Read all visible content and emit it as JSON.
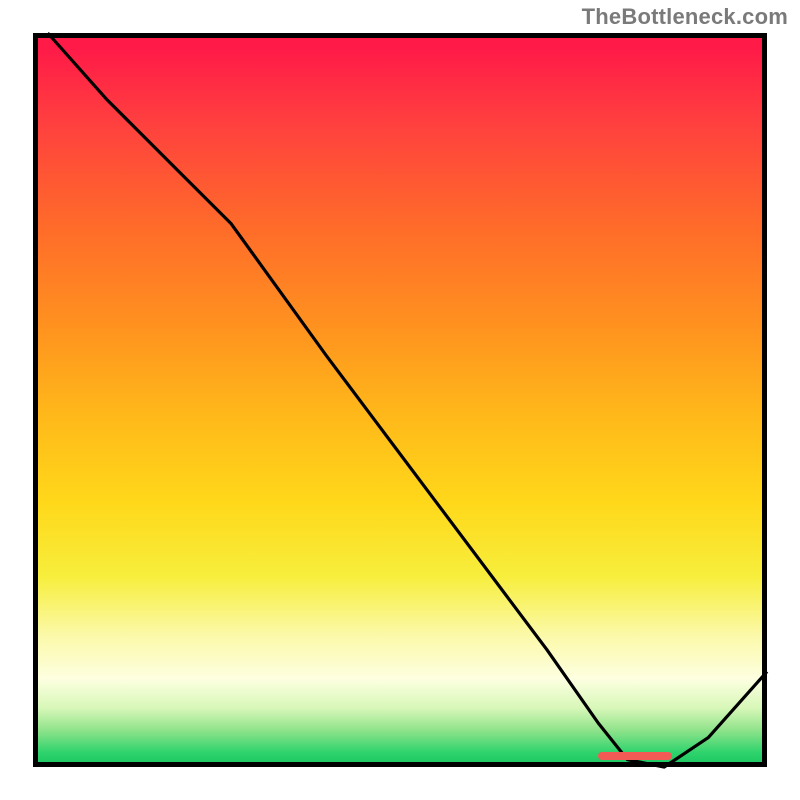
{
  "watermark": {
    "text": "TheBottleneck.com"
  },
  "chart_data": {
    "type": "line",
    "title": "",
    "xlabel": "",
    "ylabel": "",
    "xlim": [
      0,
      100
    ],
    "ylim": [
      0,
      100
    ],
    "grid": false,
    "legend": false,
    "series": [
      {
        "name": "curve",
        "x": [
          2,
          10,
          20,
          27,
          40,
          55,
          70,
          77,
          81,
          86,
          92,
          100
        ],
        "y": [
          100,
          91,
          81,
          74,
          56,
          36,
          16,
          6,
          1,
          0,
          4,
          13
        ]
      }
    ],
    "marker": {
      "x_start": 77,
      "x_end": 87,
      "y_fraction_from_top": 0.985
    },
    "gradient_note": "vertical red→orange→yellow→pale→green heatmap fill",
    "colors": {
      "curve": "#000000",
      "frame": "#000000",
      "marker": "#f15a55",
      "watermark": "#7a7a7a"
    }
  }
}
